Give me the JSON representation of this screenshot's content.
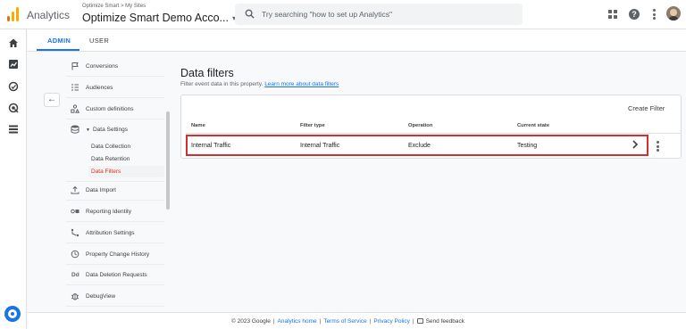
{
  "header": {
    "app_name": "Analytics",
    "breadcrumb": "Optimize Smart > My Sites",
    "account_name": "Optimize Smart Demo Acco...",
    "account_caret": "▾",
    "search_placeholder": "Try searching \"how to set up Analytics\"",
    "help_glyph": "?",
    "icons": [
      "analytics-logo-icon",
      "search-icon",
      "apps-grid-icon",
      "help-icon",
      "more-vert-icon",
      "avatar"
    ]
  },
  "rail": {
    "items": [
      "home-icon",
      "reports-icon",
      "explore-icon",
      "advertising-icon",
      "configure-icon"
    ],
    "settings_icon": "settings-gear-icon"
  },
  "tabs": {
    "admin": "ADMIN",
    "user": "USER"
  },
  "collapse_glyph": "←",
  "nav": {
    "items": [
      {
        "label": "Conversions",
        "icon": "flag-icon"
      },
      {
        "label": "Audiences",
        "icon": "audiences-icon"
      },
      {
        "label": "Custom definitions",
        "icon": "custom-definitions-icon"
      },
      {
        "label": "Data Settings",
        "icon": "database-icon",
        "expanded": true
      },
      {
        "label": "Data Import",
        "icon": "upload-icon"
      },
      {
        "label": "Reporting Identity",
        "icon": "reporting-identity-icon"
      },
      {
        "label": "Attribution Settings",
        "icon": "attribution-icon"
      },
      {
        "label": "Property Change History",
        "icon": "history-icon"
      },
      {
        "label": "Data Deletion Requests",
        "icon": "data-deletion-icon"
      },
      {
        "label": "DebugView",
        "icon": "debug-icon"
      }
    ],
    "data_settings_sub": [
      "Data Collection",
      "Data Retention",
      "Data Filters"
    ],
    "active_sub": "Data Filters",
    "dd_glyph": "Dd"
  },
  "main": {
    "title": "Data filters",
    "description": "Filter event data in this property.",
    "learn_more": "Learn more about data filters",
    "create_button": "Create Filter",
    "columns": [
      "Name",
      "Filter type",
      "Operation",
      "Current state"
    ],
    "rows": [
      {
        "name": "Internal Traffic",
        "filter_type": "Internal Traffic",
        "operation": "Exclude",
        "state": "Testing"
      }
    ]
  },
  "footer": {
    "copyright": "© 2023 Google",
    "links": [
      "Analytics home",
      "Terms of Service",
      "Privacy Policy"
    ],
    "separator": "|",
    "feedback": "Send feedback"
  },
  "colors": {
    "accent": "#1a73e8",
    "active_red": "#d93025",
    "highlight_border": "#d32f2f",
    "logo_orange": "#f9ab00",
    "logo_dark_orange": "#e37400"
  }
}
